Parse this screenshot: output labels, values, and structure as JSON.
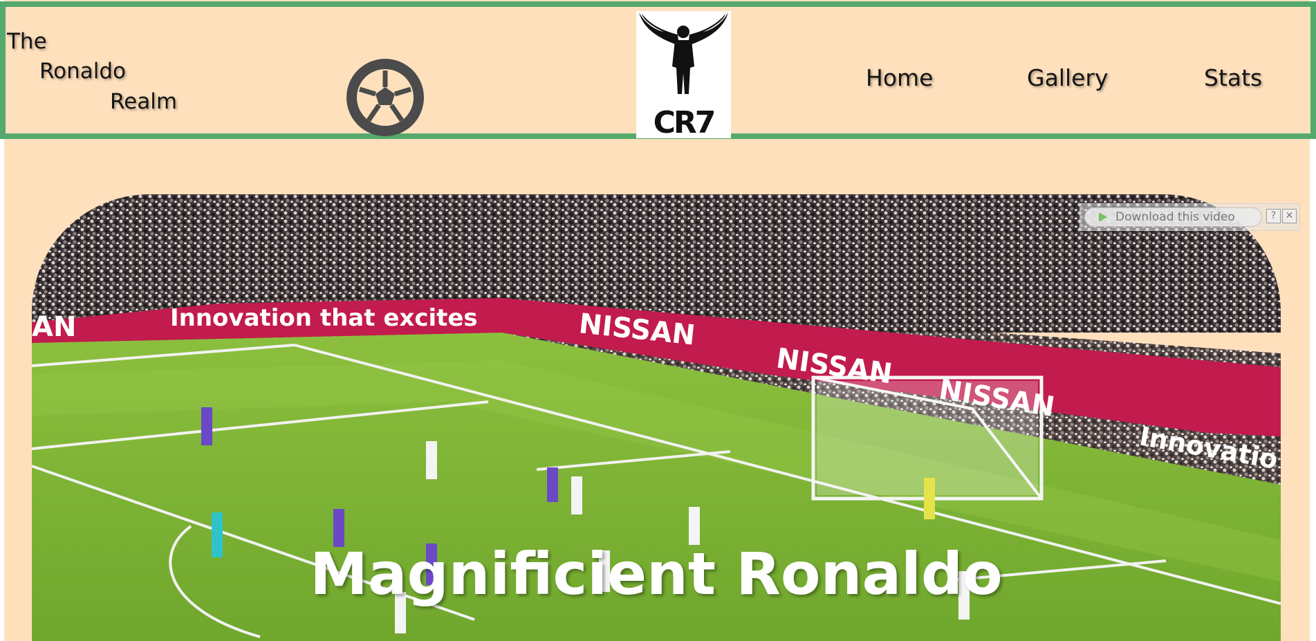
{
  "brand": {
    "line1": "The",
    "line2": "Ronaldo",
    "line3": "Realm"
  },
  "logo": {
    "text": "CR7"
  },
  "nav": [
    {
      "label": "Home"
    },
    {
      "label": "Gallery"
    },
    {
      "label": "Stats"
    }
  ],
  "hero": {
    "title": "Magnificient Ronaldo",
    "boards": {
      "banner1": "Innovation that excites",
      "banner1_prefix": "AN",
      "sponsor": "NISSAN",
      "banner2": "Innovatio"
    }
  },
  "download_bar": {
    "label": "Download this video",
    "help": "?",
    "close": "✕"
  },
  "colors": {
    "page": "#ffe0bd",
    "header_border": "#55a96c",
    "pitch": "#7fb236",
    "banner": "#c21b4e"
  },
  "icons": [
    "soccer-ball-icon",
    "winged-player-icon",
    "play-icon",
    "help-icon",
    "close-icon"
  ]
}
